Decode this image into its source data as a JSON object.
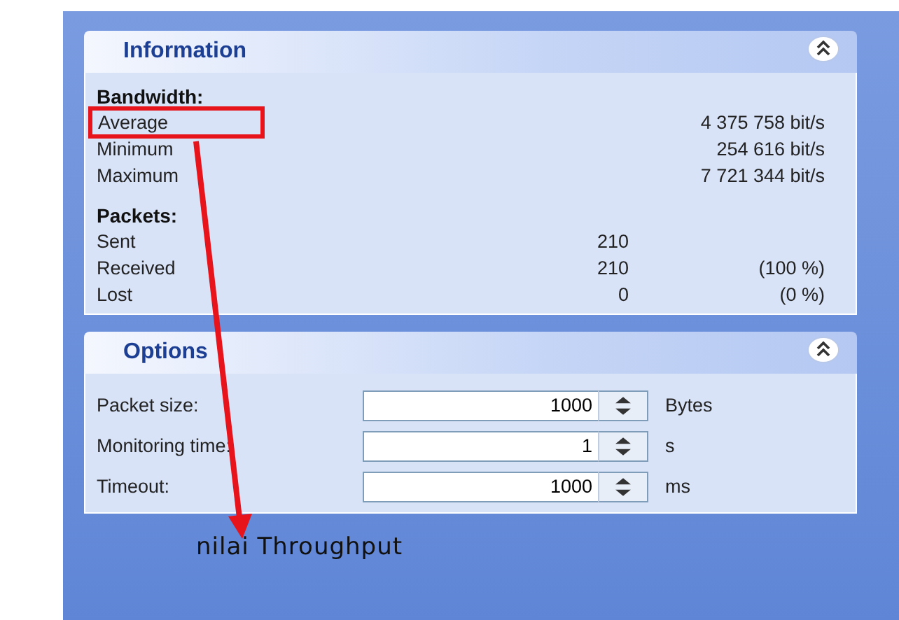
{
  "information": {
    "title": "Information",
    "expanded": true,
    "bandwidth": {
      "heading": "Bandwidth:",
      "rows": [
        {
          "label": "Average",
          "value": "4 375 758 bit/s"
        },
        {
          "label": "Minimum",
          "value": "254 616 bit/s"
        },
        {
          "label": "Maximum",
          "value": "7 721 344 bit/s"
        }
      ]
    },
    "packets": {
      "heading": "Packets:",
      "rows": [
        {
          "label": "Sent",
          "count": "210"
        },
        {
          "label": "Received",
          "count": "210",
          "percent": "(100 %)"
        },
        {
          "label": "Lost",
          "count": "0",
          "percent": "(0 %)"
        }
      ]
    }
  },
  "options": {
    "title": "Options",
    "expanded": true,
    "rows": [
      {
        "label": "Packet size:",
        "value": "1000",
        "unit": "Bytes"
      },
      {
        "label": "Monitoring time:",
        "value": "1",
        "unit": "s"
      },
      {
        "label": "Timeout:",
        "value": "1000",
        "unit": "ms"
      }
    ]
  },
  "annotation": {
    "caption": "nilai Throughput"
  }
}
